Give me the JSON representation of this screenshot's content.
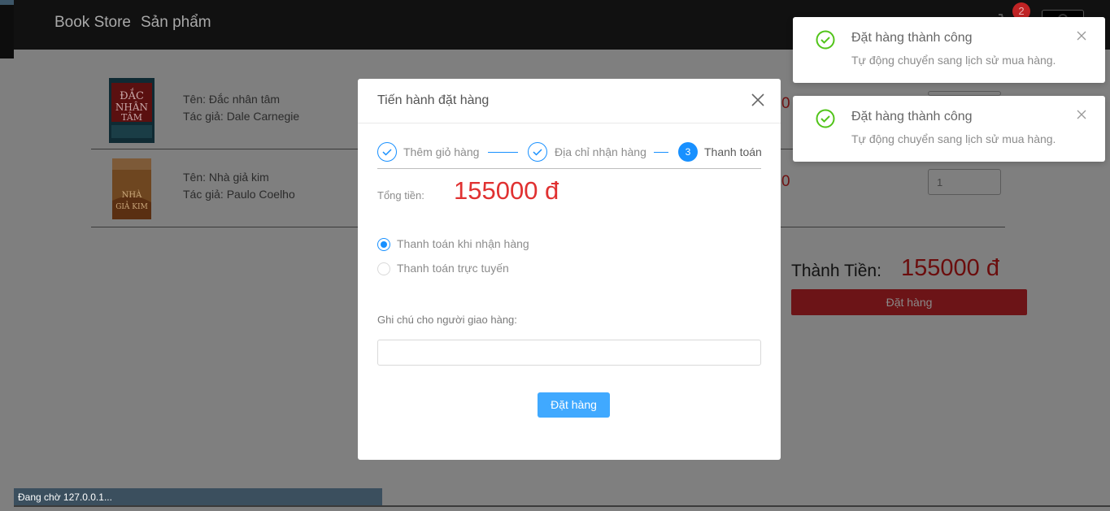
{
  "navbar": {
    "brand": "Book Store",
    "products_link": "Sản phẩm",
    "cart_count": "2"
  },
  "cart_items": [
    {
      "name": "Tên: Đắc nhân tâm",
      "author": "Tác giả: Dale Carnegie",
      "quantity": ""
    },
    {
      "name": "Tên: Nhà giả kim",
      "author": "Tác giả: Paulo Coelho",
      "quantity": "1"
    }
  ],
  "cart_summary": {
    "total_label": "Thành Tiền:",
    "total_value": "155000 đ",
    "order_button": "Đặt hàng"
  },
  "modal": {
    "title": "Tiến hành đặt hàng",
    "steps": [
      {
        "label": "Thêm giỏ hàng",
        "status": "done"
      },
      {
        "label": "Địa chỉ nhận hàng",
        "status": "done"
      },
      {
        "label": "Thanh toán",
        "status": "active",
        "number": "3"
      }
    ],
    "total_label": "Tổng tiền:",
    "total_value": "155000 đ",
    "payment_options": [
      {
        "label": "Thanh toán khi nhận hàng",
        "checked": true
      },
      {
        "label": "Thanh toán trực tuyến",
        "checked": false
      }
    ],
    "note_label": "Ghi chú cho người giao hàng:",
    "note_value": "",
    "submit_button": "Đặt hàng"
  },
  "notifications": [
    {
      "title": "Đặt hàng thành công",
      "description": "Tự động chuyển sang lịch sử mua hàng."
    },
    {
      "title": "Đặt hàng thành công",
      "description": "Tự động chuyển sang lịch sử mua hàng."
    }
  ],
  "status_bar": {
    "text": "Đang chờ 127.0.0.1..."
  },
  "colors": {
    "primary": "#1890ff",
    "price_red": "#e03131",
    "success_green": "#52c41a",
    "navbar": "#111111"
  }
}
